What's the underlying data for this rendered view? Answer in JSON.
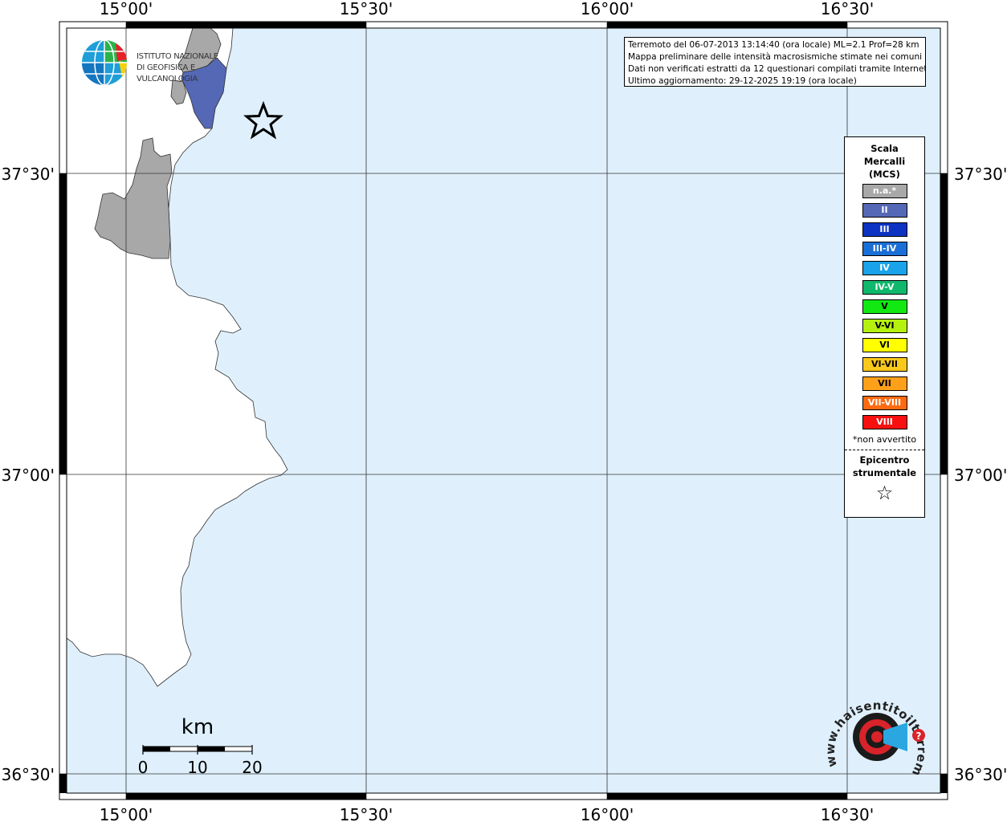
{
  "map": {
    "title": "",
    "top_lon_labels": [
      "15°00'",
      "15°30'",
      "16°00'",
      "16°30'"
    ],
    "bottom_lon_labels": [
      "15°00'",
      "15°30'",
      "16°00'",
      "16°30'"
    ],
    "left_lat_labels": [
      "37°30'",
      "37°00'",
      "36°30'"
    ],
    "right_lat_labels": [
      "37°30'",
      "37°00'",
      "36°30'"
    ],
    "sea_color": "#dff0fc",
    "land_color": "#ffffff",
    "no_data_color": "#a8a8a8",
    "intensity_ii_color": "#5568b6"
  },
  "info": {
    "line1": "Terremoto del 06-07-2013 13:14:40 (ora locale) ML=2.1 Prof=28 km",
    "line2": "Mappa preliminare delle intensità macrosismiche stimate nei comuni",
    "line3": "Dati non verificati estratti da 12 questionari compilati tramite Internet.",
    "line4": "Ultimo aggiornamento: 29-12-2025 19:19 (ora locale)"
  },
  "legend": {
    "title_line1": "Scala",
    "title_line2": "Mercalli",
    "title_line3": "(MCS)",
    "items": [
      {
        "label": "n.a.*",
        "color": "#a8a8a8"
      },
      {
        "label": "II",
        "color": "#5568b6"
      },
      {
        "label": "III",
        "color": "#0d33c2"
      },
      {
        "label": "III-IV",
        "color": "#1a6fd6"
      },
      {
        "label": "IV",
        "color": "#1aa3e8"
      },
      {
        "label": "IV-V",
        "color": "#0fb86b"
      },
      {
        "label": "V",
        "color": "#12e812"
      },
      {
        "label": "V-VI",
        "color": "#b5f00f"
      },
      {
        "label": "VI",
        "color": "#ffff00"
      },
      {
        "label": "VI-VII",
        "color": "#f8c81a"
      },
      {
        "label": "VII",
        "color": "#ffa01a"
      },
      {
        "label": "VII-VIII",
        "color": "#ff6a10"
      },
      {
        "label": "VIII",
        "color": "#f80f0f"
      }
    ],
    "note": "*non avvertito",
    "epicenter_line1": "Epicentro",
    "epicenter_line2": "strumentale",
    "star": "☆"
  },
  "scale_bar": {
    "unit": "km",
    "ticks": [
      "0",
      "10",
      "20"
    ]
  },
  "logos": {
    "ingv_line1": "ISTITUTO NAZIONALE",
    "ingv_line2": "DI GEOFISICA E VULCANOLOGIA",
    "hst_text": "www.haisentitoilterremoto.it"
  }
}
